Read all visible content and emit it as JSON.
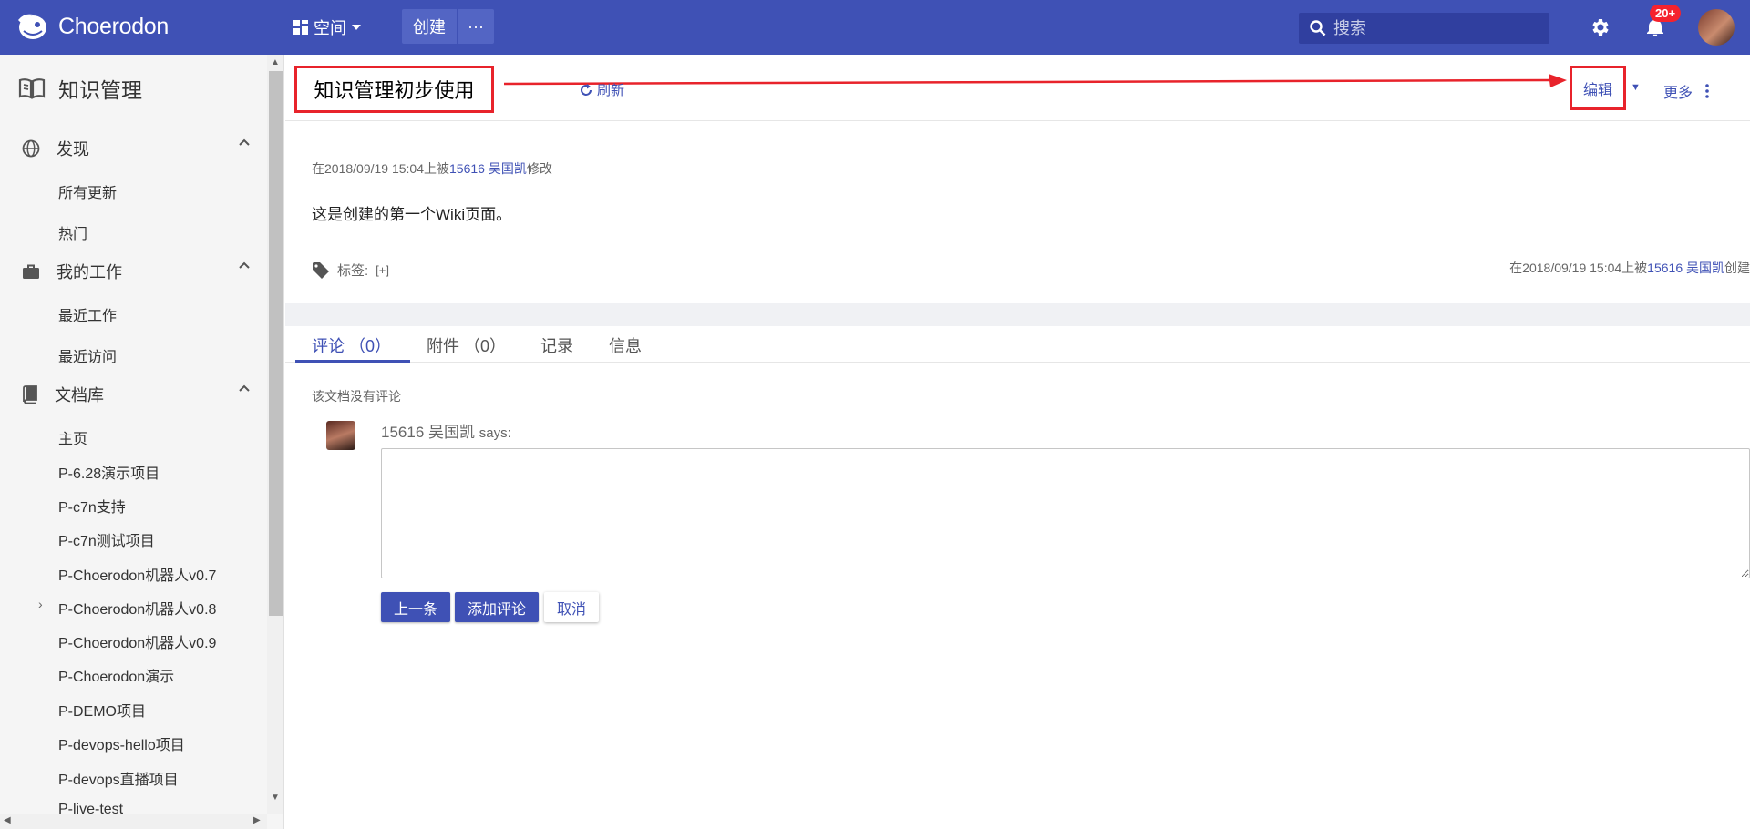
{
  "header": {
    "logo_text": "Choerodon",
    "space_label": "空间",
    "create_label": "创建",
    "more_label": "···",
    "search_placeholder": "搜索",
    "notification_count": "20+"
  },
  "sidebar": {
    "title": "知识管理",
    "sections": [
      {
        "label": "发现",
        "icon": "globe-icon",
        "items": [
          "所有更新",
          "热门"
        ]
      },
      {
        "label": "我的工作",
        "icon": "briefcase-icon",
        "items": [
          "最近工作",
          "最近访问"
        ]
      },
      {
        "label": "文档库",
        "icon": "book-icon",
        "items": [
          "主页",
          "P-6.28演示项目",
          "P-c7n支持",
          "P-c7n测试项目",
          "P-Choerodon机器人v0.7",
          "P-Choerodon机器人v0.8",
          "P-Choerodon机器人v0.9",
          "P-Choerodon演示",
          "P-DEMO项目",
          "P-devops-hello项目",
          "P-devops直播项目",
          "P-live-test"
        ]
      }
    ]
  },
  "page": {
    "title": "知识管理初步使用",
    "refresh_label": "刷新",
    "edit_label": "编辑",
    "more_label": "更多",
    "modified_prefix": "在2018/09/19 15:04上被",
    "modified_user": "15616 吴国凯",
    "modified_suffix": "修改",
    "content": "这是创建的第一个Wiki页面。",
    "tags_label": "标签:",
    "tags_add": "[+]",
    "created_prefix": "在2018/09/19 15:04上被",
    "created_user": "15616 吴国凯",
    "created_suffix": "创建"
  },
  "tabs": [
    {
      "label": "评论 （0）",
      "active": true
    },
    {
      "label": "附件 （0）",
      "active": false
    },
    {
      "label": "记录",
      "active": false
    },
    {
      "label": "信息",
      "active": false
    }
  ],
  "comments": {
    "empty_text": "该文档没有评论",
    "author": "15616 吴国凯",
    "says": "says:",
    "textarea_value": "",
    "prev_label": "上一条",
    "add_label": "添加评论",
    "cancel_label": "取消"
  },
  "colors": {
    "primary": "#3f51b5",
    "annotation_red": "#e8232b"
  }
}
